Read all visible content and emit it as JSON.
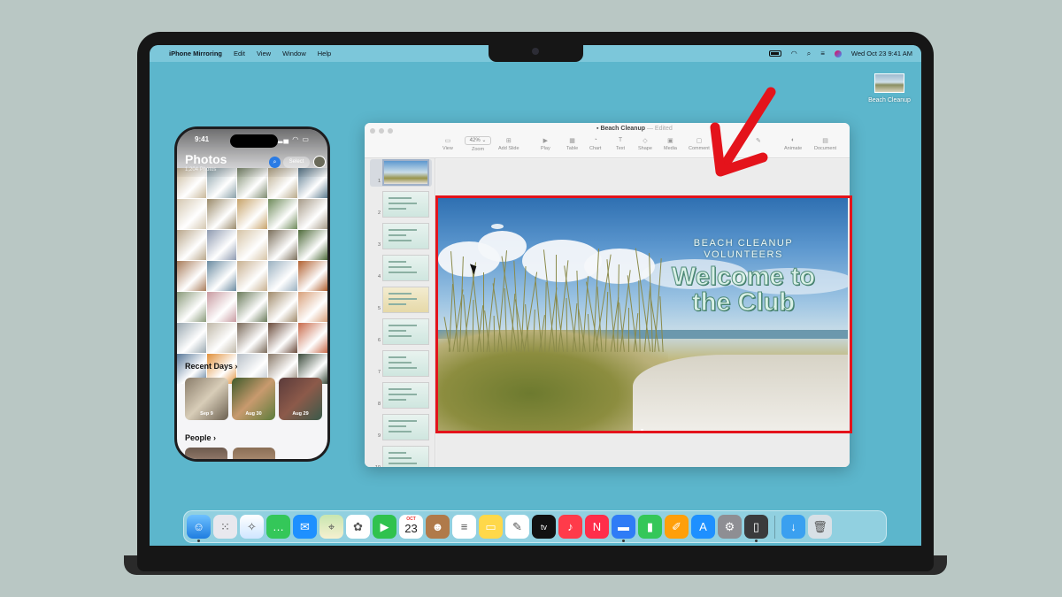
{
  "menubar": {
    "app": "iPhone Mirroring",
    "items": [
      "Edit",
      "View",
      "Window",
      "Help"
    ],
    "datetime": "Wed Oct 23  9:41 AM"
  },
  "desktop": {
    "file_label": "Beach Cleanup"
  },
  "phone": {
    "time": "9:41",
    "title": "Photos",
    "count": "1,204 Photos",
    "select": "Select",
    "recent_header": "Recent Days",
    "recent": [
      "Sep 9",
      "Aug 30",
      "Aug 29"
    ],
    "people_header": "People"
  },
  "keynote": {
    "doc_title": "Beach Cleanup",
    "edited": "— Edited",
    "zoom": "42%",
    "toolbar": [
      "View",
      "Zoom",
      "Add Slide",
      "Play",
      "Table",
      "Chart",
      "Text",
      "Shape",
      "Media",
      "Comment",
      "Format",
      "Animate",
      "Document"
    ],
    "slide_numbers": [
      "1",
      "2",
      "3",
      "4",
      "5",
      "6",
      "7",
      "8",
      "9",
      "10"
    ],
    "slide": {
      "subtitle_line1": "BEACH CLEANUP",
      "subtitle_line2": "VOLUNTEERS",
      "title_line1": "Welcome to",
      "title_line2": "the Club"
    }
  },
  "dock": {
    "apps": [
      "Finder",
      "Launchpad",
      "Safari",
      "Messages",
      "Mail",
      "Maps",
      "Photos",
      "FaceTime",
      "Calendar",
      "Contacts",
      "Reminders",
      "Notes",
      "Freeform",
      "TV",
      "Music",
      "News",
      "Keynote",
      "Numbers",
      "Pages",
      "App Store",
      "System Settings",
      "iPhone Mirroring",
      "Downloads",
      "Trash"
    ],
    "calendar_month": "OCT",
    "calendar_day": "23"
  },
  "colors": {
    "desktop": "#5cb6cc",
    "annotation": "#e4131b"
  }
}
